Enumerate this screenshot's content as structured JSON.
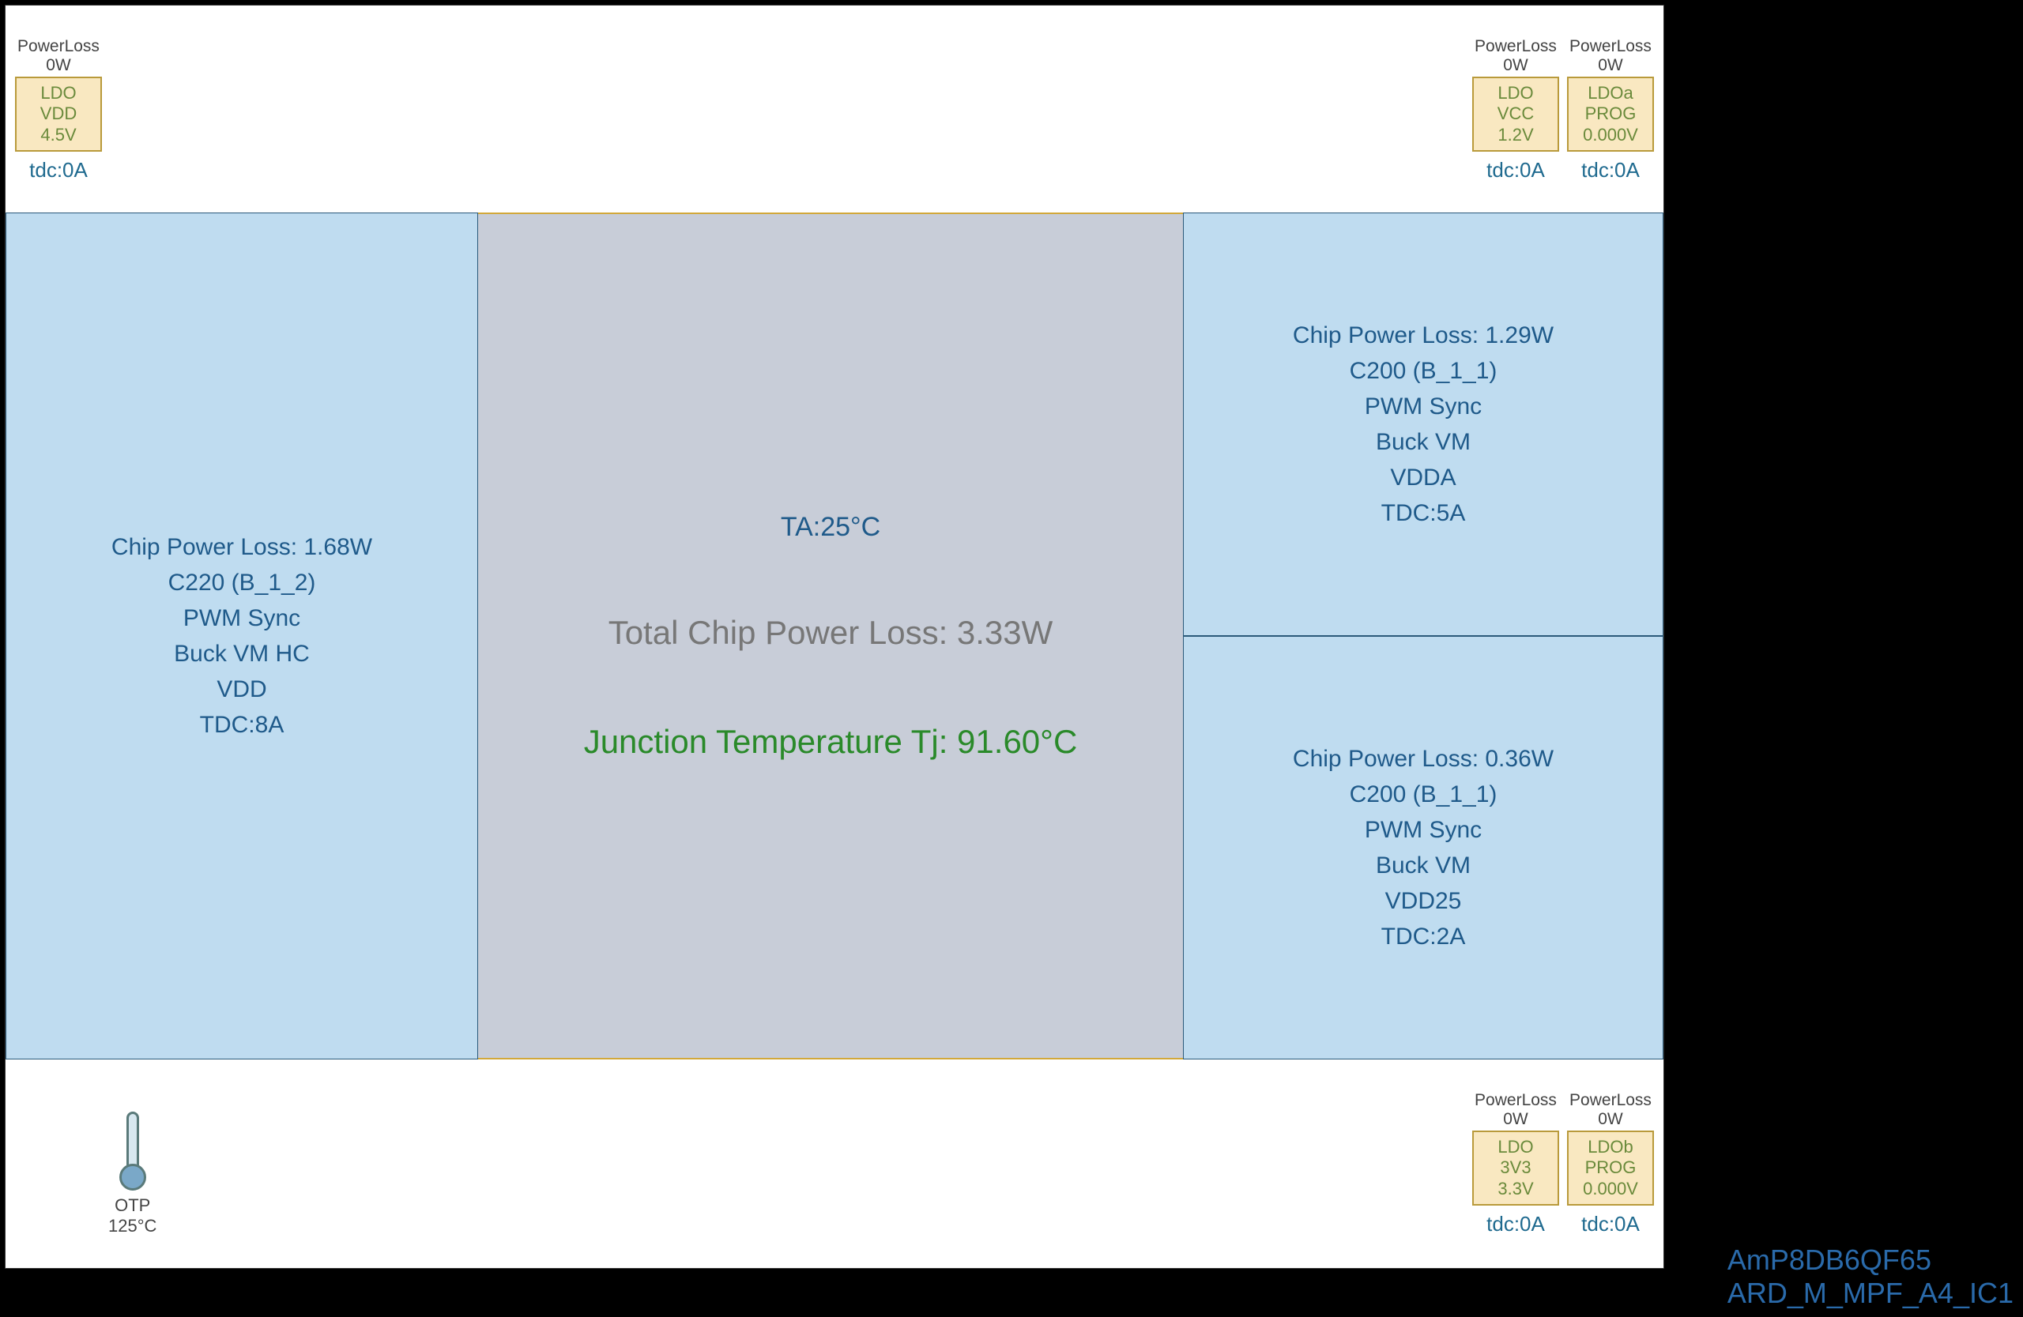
{
  "ldos_top_left": [
    {
      "power_loss_label": "PowerLoss",
      "power_loss": "0W",
      "l1": "LDO",
      "l2": "VDD",
      "l3": "4.5V",
      "tdc": "tdc:0A"
    }
  ],
  "ldos_top_right": [
    {
      "power_loss_label": "PowerLoss",
      "power_loss": "0W",
      "l1": "LDO",
      "l2": "VCC",
      "l3": "1.2V",
      "tdc": "tdc:0A"
    },
    {
      "power_loss_label": "PowerLoss",
      "power_loss": "0W",
      "l1": "LDOa",
      "l2": "PROG",
      "l3": "0.000V",
      "tdc": "tdc:0A"
    }
  ],
  "ldos_bottom_right": [
    {
      "power_loss_label": "PowerLoss",
      "power_loss": "0W",
      "l1": "LDO",
      "l2": "3V3",
      "l3": "3.3V",
      "tdc": "tdc:0A"
    },
    {
      "power_loss_label": "PowerLoss",
      "power_loss": "0W",
      "l1": "LDOb",
      "l2": "PROG",
      "l3": "0.000V",
      "tdc": "tdc:0A"
    }
  ],
  "left_block": {
    "chip_power_loss": "Chip Power Loss: 1.68W",
    "id": "C220 (B_1_2)",
    "mode": "PWM Sync",
    "type": "Buck VM HC",
    "rail": "VDD",
    "tdc": "TDC:8A"
  },
  "right_block_top": {
    "chip_power_loss": "Chip Power Loss: 1.29W",
    "id": "C200 (B_1_1)",
    "mode": "PWM Sync",
    "type": "Buck VM",
    "rail": "VDDA",
    "tdc": "TDC:5A"
  },
  "right_block_bottom": {
    "chip_power_loss": "Chip Power Loss: 0.36W",
    "id": "C200 (B_1_1)",
    "mode": "PWM Sync",
    "type": "Buck VM",
    "rail": "VDD25",
    "tdc": "TDC:2A"
  },
  "center": {
    "ta": "TA:25°C",
    "total_power_loss": "Total Chip Power Loss: 3.33W",
    "tj": "Junction Temperature Tj: 91.60°C"
  },
  "otp": {
    "label": "OTP",
    "value": "125°C"
  },
  "footer": {
    "line1": "AmP8DB6QF65",
    "line2": "ARD_M_MPF_A4_IC1"
  }
}
